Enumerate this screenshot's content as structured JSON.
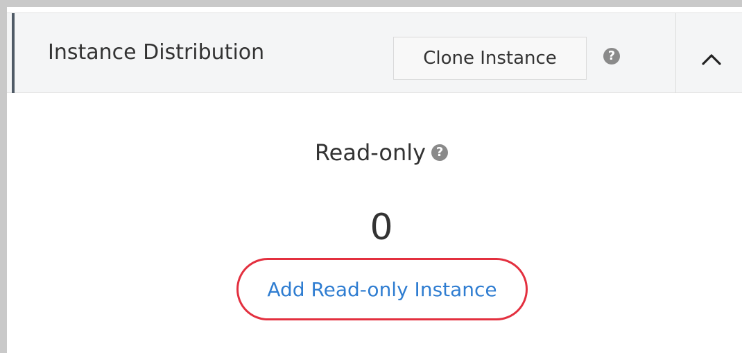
{
  "panel": {
    "title": "Instance Distribution",
    "clone_button_label": "Clone Instance",
    "help_icon_glyph": "?",
    "collapse_icon": "chevron-up-icon"
  },
  "readonly": {
    "label": "Read-only",
    "help_icon_glyph": "?",
    "count": "0",
    "add_link_label": "Add Read-only Instance"
  },
  "colors": {
    "panel_header_background": "#f4f5f6",
    "header_accent": "#4f5a66",
    "link": "#2f7dd1",
    "highlight_outline": "#e3303f"
  }
}
